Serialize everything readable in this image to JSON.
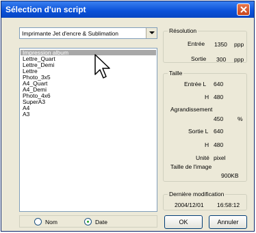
{
  "window": {
    "title": "Sélection d'un script"
  },
  "printer_dropdown": {
    "value": "Imprimante Jet d'encre & Sublimation"
  },
  "script_list": [
    {
      "label": "Impression album",
      "selected": true
    },
    {
      "label": "Lettre_Quart",
      "selected": false
    },
    {
      "label": "Lettre_Demi",
      "selected": false
    },
    {
      "label": "Lettre",
      "selected": false
    },
    {
      "label": "Photo_3x5",
      "selected": false
    },
    {
      "label": "A4_Quart",
      "selected": false
    },
    {
      "label": "A4_Demi",
      "selected": false
    },
    {
      "label": "Photo_4x6",
      "selected": false
    },
    {
      "label": "SuperA3",
      "selected": false
    },
    {
      "label": "A4",
      "selected": false
    },
    {
      "label": "A3",
      "selected": false
    }
  ],
  "resolution": {
    "legend": "Résolution",
    "input_label": "Entrée",
    "input_value": "1350",
    "input_unit": "ppp",
    "output_label": "Sortie",
    "output_value": "300",
    "output_unit": "ppp"
  },
  "size": {
    "legend": "Taille",
    "input_l_label": "Entrée L",
    "input_l_value": "640",
    "input_h_label": "H",
    "input_h_value": "480",
    "enlarge_label": "Agrandissement",
    "enlarge_value": "450",
    "enlarge_unit": "%",
    "output_l_label": "Sortie L",
    "output_l_value": "640",
    "output_h_label": "H",
    "output_h_value": "480",
    "unit_label": "Unité",
    "unit_value": "pixel",
    "image_size_label": "Taille de l'image",
    "image_size_value": "900KB"
  },
  "last_modified": {
    "legend": "Dernière modification",
    "date": "2004/12/01",
    "time": "16:58:12"
  },
  "sort": {
    "name_label": "Nom",
    "date_label": "Date",
    "selected": "Date"
  },
  "buttons": {
    "ok": "OK",
    "cancel": "Annuler"
  },
  "colors": {
    "title_bar": "#0a50d8",
    "selection": "#a8a8a8",
    "dialog_bg": "#ece9d8"
  }
}
